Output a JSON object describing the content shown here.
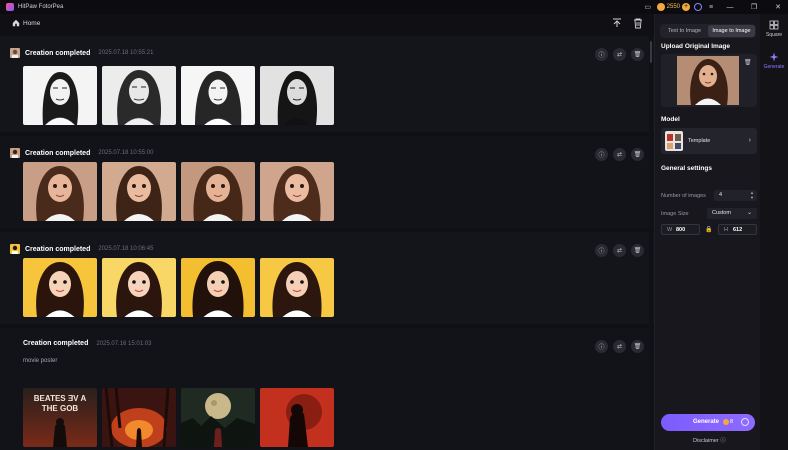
{
  "app": {
    "title": "HitPaw FotorPea"
  },
  "titlebar": {
    "credits": "2550"
  },
  "header": {
    "home_label": "Home"
  },
  "sections": [
    {
      "title": "Creation completed",
      "date": "2025.07.18  10:55:21",
      "prompt": ""
    },
    {
      "title": "Creation completed",
      "date": "2025.07.18  10:55:00",
      "prompt": ""
    },
    {
      "title": "Creation completed",
      "date": "2025.07.18  10:06:45",
      "prompt": ""
    },
    {
      "title": "Creation completed",
      "date": "2025.07.16  15:01:03",
      "prompt": "movie poster"
    }
  ],
  "poster_text": {
    "line1": "BEATES ƎV A",
    "line2": "THE GOB"
  },
  "panel": {
    "tabs": [
      "Text to Image",
      "Image to Image"
    ],
    "active_tab": 1,
    "upload_label": "Upload Original Image",
    "model_label": "Model",
    "model_name": "Template",
    "general_label": "General settings",
    "num_images_label": "Number of images",
    "num_images": "4",
    "image_size_label": "Image Size",
    "image_size": "Custom",
    "width_key": "W",
    "width": "800",
    "height_key": "H",
    "height": "612",
    "generate_label": "Generate",
    "generate_cost": "8",
    "disclaimer": "Disclaimer ⓘ"
  },
  "rail": {
    "items": [
      "Square",
      "Generate"
    ]
  },
  "colors": {
    "accent": "#7c5cff",
    "coin": "#f3a93b"
  }
}
